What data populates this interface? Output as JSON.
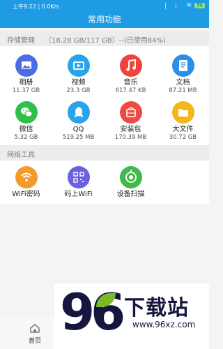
{
  "status_bar": {
    "left": "上午9:22 | 0.0K/s",
    "battery": "71"
  },
  "header": {
    "title": "常用功能"
  },
  "storage": {
    "label": "存储管理",
    "summary": "（18.28 GB/117 GB）--(已使用84%)",
    "items": [
      {
        "label": "相册",
        "size": "11.37 GB",
        "icon": "photo-album-icon",
        "color": "#4a6de2"
      },
      {
        "label": "视频",
        "size": "23.3 GB",
        "icon": "video-icon",
        "color": "#2aa3e8"
      },
      {
        "label": "音乐",
        "size": "617.47 KB",
        "icon": "music-icon",
        "color": "#f0433c"
      },
      {
        "label": "文档",
        "size": "87.21 MB",
        "icon": "document-icon",
        "color": "#2a8fe8"
      },
      {
        "label": "微信",
        "size": "5.32 GB",
        "icon": "wechat-icon",
        "color": "#2fbf4a"
      },
      {
        "label": "QQ",
        "size": "519.25 MB",
        "icon": "qq-icon",
        "color": "#2aa3e8"
      },
      {
        "label": "安装包",
        "size": "170.39 MB",
        "icon": "apk-package-icon",
        "color": "#ef4a44"
      },
      {
        "label": "大文件",
        "size": "30.72 GB",
        "icon": "folder-icon",
        "color": "#f5b51c"
      }
    ]
  },
  "network": {
    "label": "网络工具",
    "items": [
      {
        "label": "WiFi密码",
        "icon": "wifi-password-icon",
        "color": "#f29a2c"
      },
      {
        "label": "码上WiFi",
        "icon": "qr-code-icon",
        "color": "#6a60e0"
      },
      {
        "label": "设备扫描",
        "icon": "device-scan-icon",
        "color": "#3fba4a"
      }
    ]
  },
  "bottom_nav": {
    "home": "首页"
  },
  "watermark": {
    "number": "96",
    "name": "下载站",
    "url": "www.96xz.com"
  }
}
